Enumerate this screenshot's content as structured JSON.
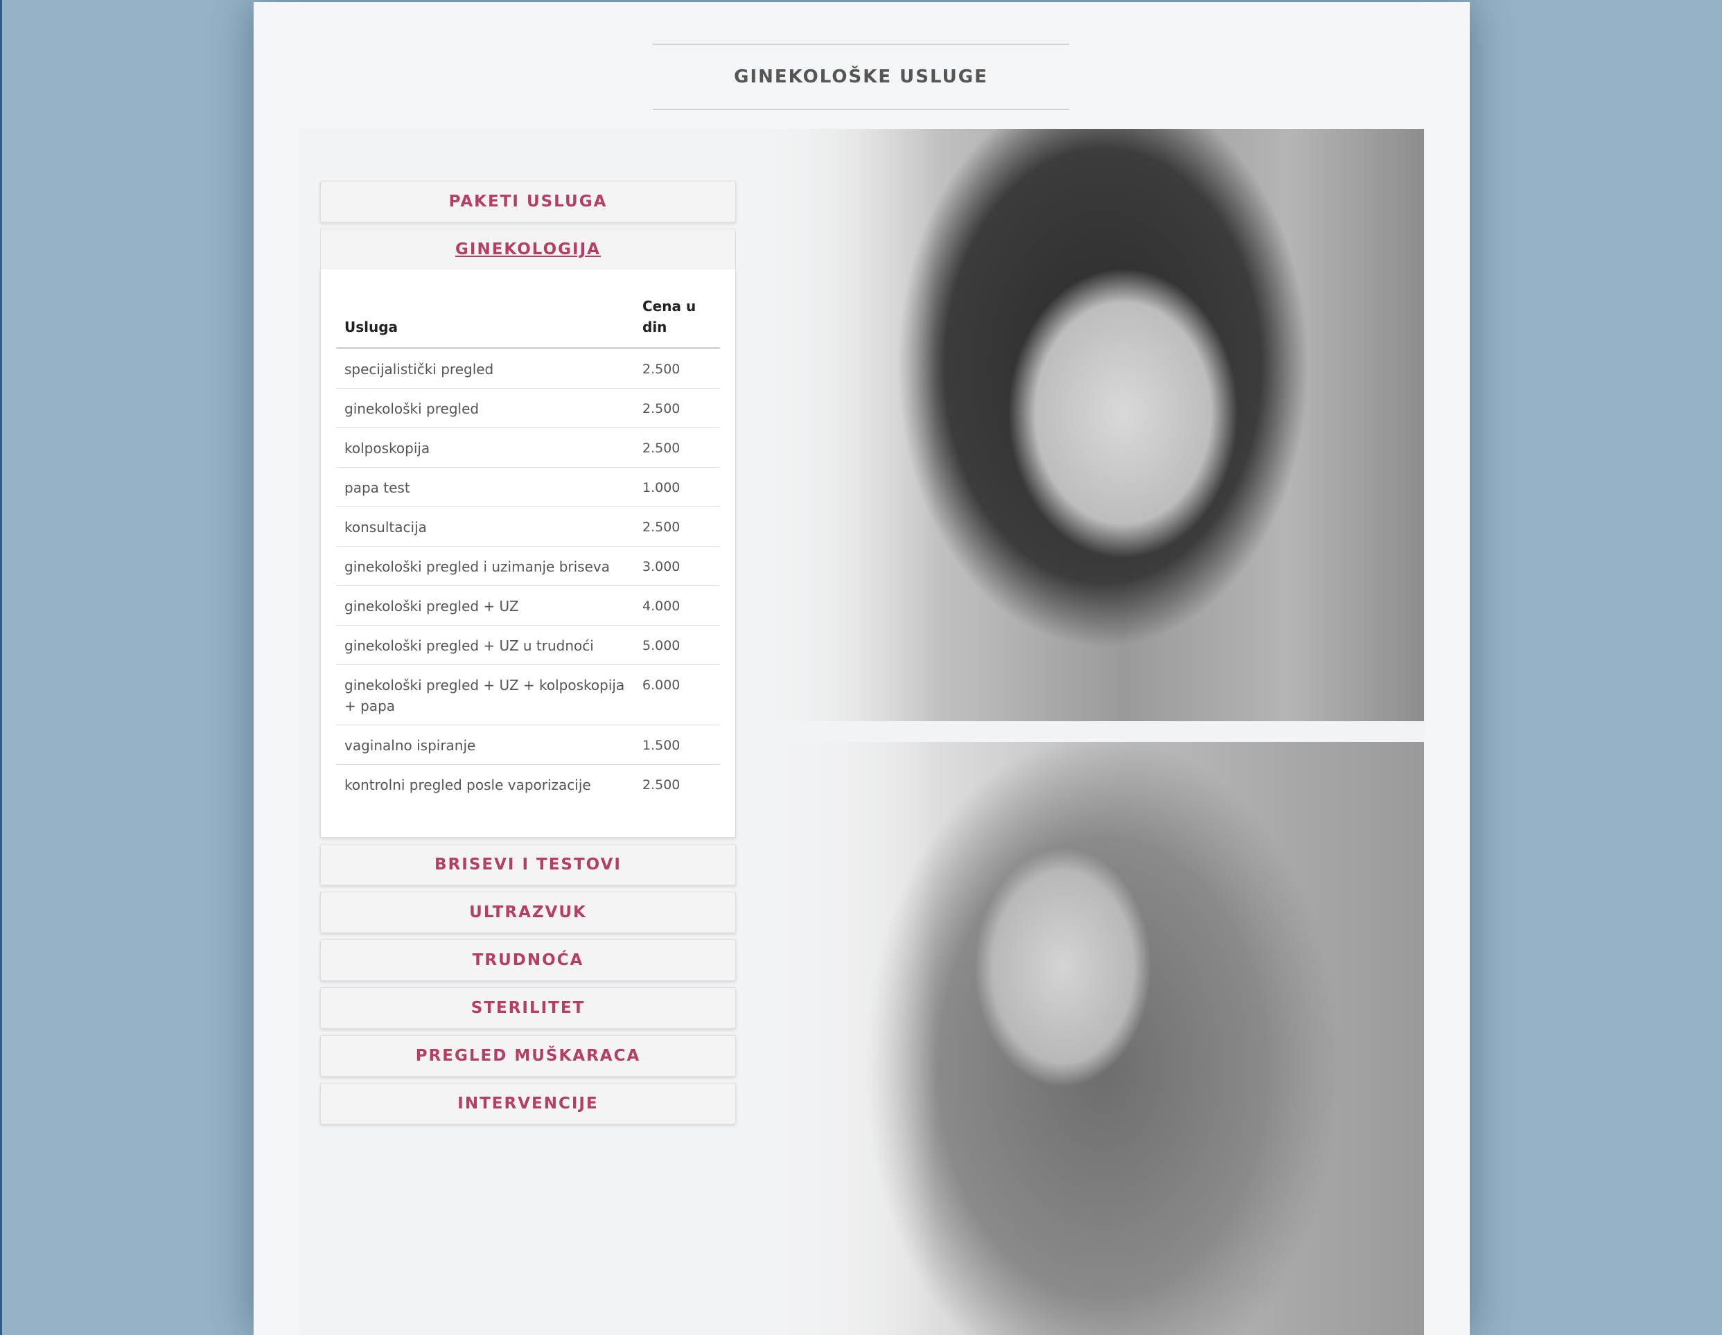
{
  "page": {
    "title": "GINEKOLOŠKE USLUGE"
  },
  "accordion": {
    "top_sections": [
      {
        "label": "PAKETI USLUGA"
      }
    ],
    "open_section": {
      "label": "GINEKOLOGIJA",
      "table": {
        "headers": [
          "Usluga",
          "Cena u din"
        ],
        "rows": [
          {
            "service": "specijalistički pregled",
            "price": "2.500"
          },
          {
            "service": "ginekološki pregled",
            "price": "2.500"
          },
          {
            "service": "kolposkopija",
            "price": "2.500"
          },
          {
            "service": "papa test",
            "price": "1.000"
          },
          {
            "service": "konsultacija",
            "price": "2.500"
          },
          {
            "service": "ginekološki pregled i uzimanje briseva",
            "price": "3.000"
          },
          {
            "service": "ginekološki pregled + UZ",
            "price": "4.000"
          },
          {
            "service": "ginekološki pregled + UZ u trudnoći",
            "price": "5.000"
          },
          {
            "service": "ginekološki pregled + UZ + kolposkopija + papa",
            "price": "6.000"
          },
          {
            "service": "vaginalno ispiranje",
            "price": "1.500"
          },
          {
            "service": "kontrolni pregled posle vaporizacije",
            "price": "2.500"
          }
        ]
      }
    },
    "bottom_sections": [
      {
        "label": "BRISEVI I TESTOVI"
      },
      {
        "label": "ULTRAZVUK"
      },
      {
        "label": "TRUDNOĆA"
      },
      {
        "label": "STERILITET"
      },
      {
        "label": "PREGLED MUŠKARACA"
      },
      {
        "label": "INTERVENCIJE"
      }
    ]
  },
  "colors": {
    "accent": "#b53e62",
    "background": "#94b3c7",
    "page": "#f4f5f6"
  }
}
